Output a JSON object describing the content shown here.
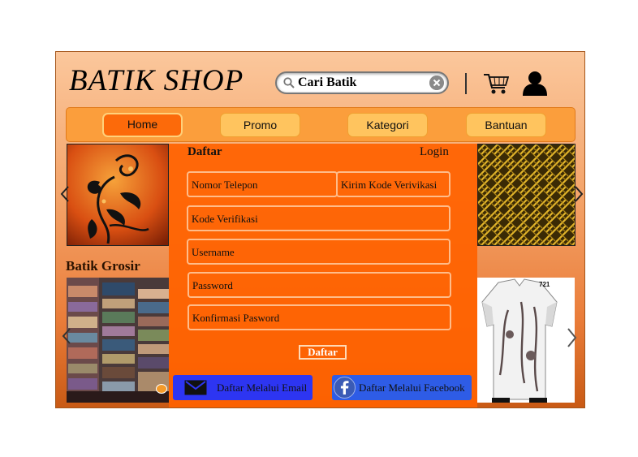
{
  "header": {
    "logo": "BATIK SHOP",
    "search_placeholder": "Cari Batik",
    "icons": [
      "search-icon",
      "clear-icon",
      "cart-icon",
      "user-icon"
    ]
  },
  "nav": {
    "items": [
      {
        "label": "Home",
        "active": true
      },
      {
        "label": "Promo",
        "active": false
      },
      {
        "label": "Kategori",
        "active": false
      },
      {
        "label": "Bantuan",
        "active": false
      }
    ]
  },
  "section": {
    "grosir_title": "Batik Grosir"
  },
  "product": {
    "code": "721"
  },
  "form": {
    "tab_daftar": "Daftar",
    "tab_login": "Login",
    "phone_label": "Nomor Telepon",
    "send_code_label": "Kirim Kode Verivikasi",
    "code_label": "Kode Verifikasi",
    "username_label": "Username",
    "password_label": "Password",
    "confirm_label": "Konfirmasi Pasword",
    "submit_label": "Daftar",
    "email_signup": "Daftar Melalui Email",
    "facebook_signup": "Daftar Melalui Facebook"
  },
  "colors": {
    "accent": "#ff6200",
    "nav_button": "#ffc45e",
    "email_button": "#2d35f2",
    "facebook_button": "#2e5ce6"
  }
}
